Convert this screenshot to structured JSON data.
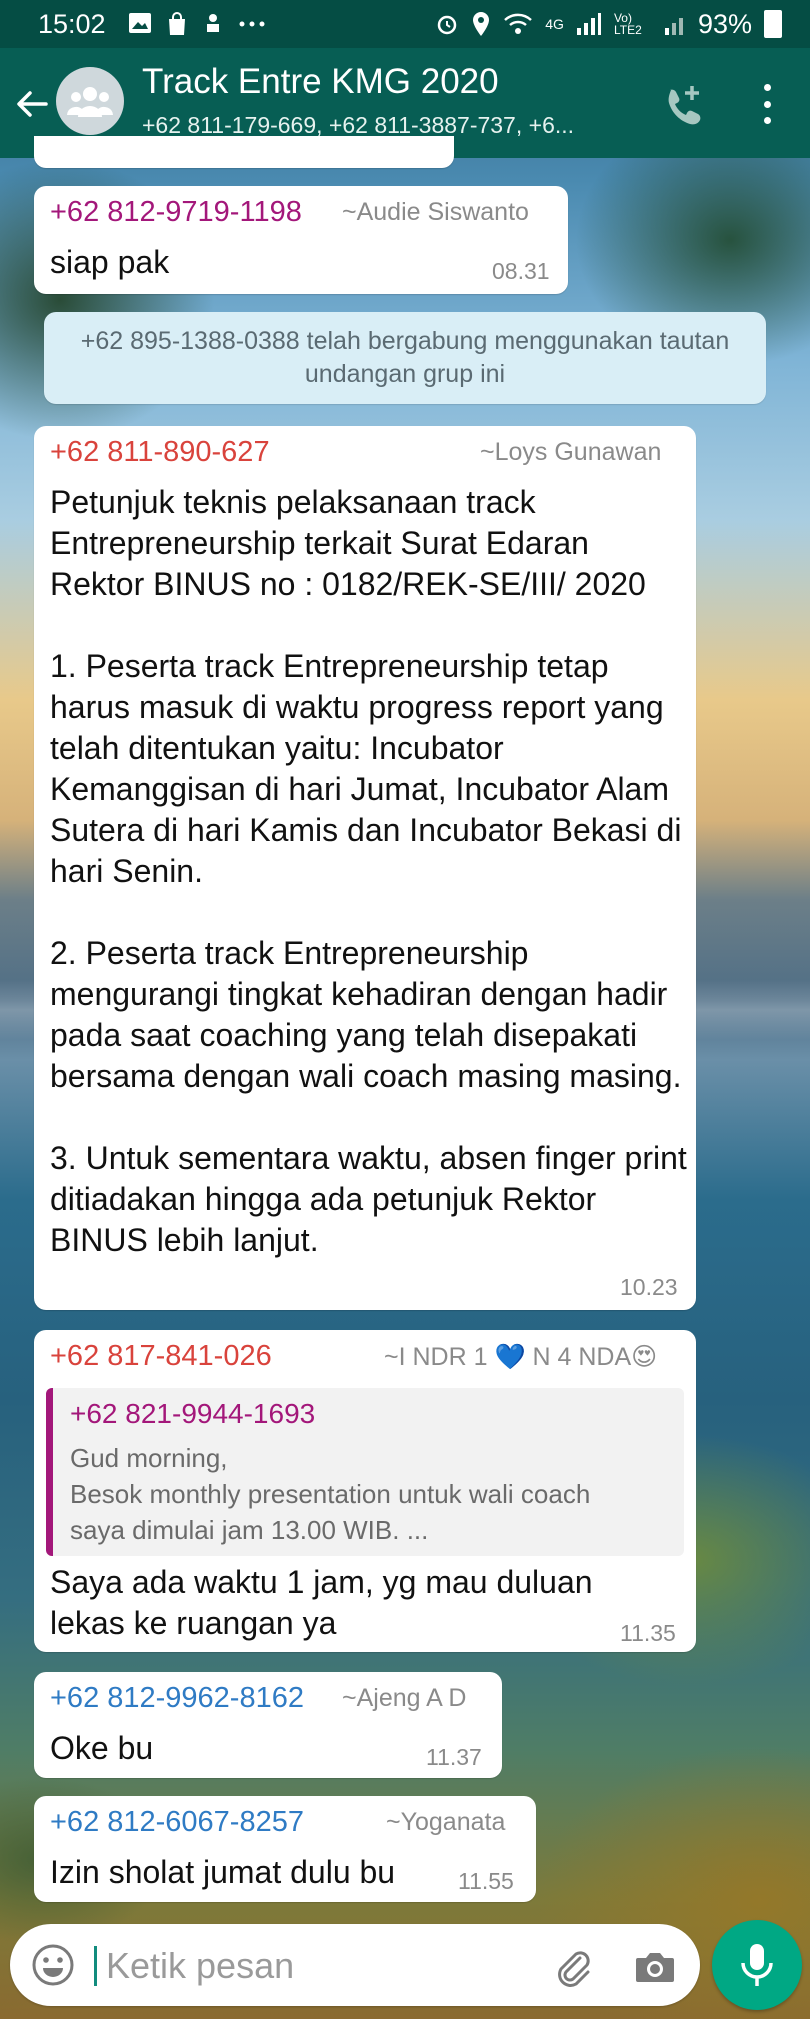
{
  "status_bar": {
    "time": "15:02",
    "network_label": "4G",
    "volte_label": "Vo) LTE2",
    "battery": "93%"
  },
  "header": {
    "title": "Track Entre KMG 2020",
    "subtitle": "+62 811-179-669, +62 811-3887-737, +6..."
  },
  "messages": [
    {
      "sender": "+62 812-9719-1198",
      "sender_color": "#a3177a",
      "alias": "~Audie Siswanto",
      "text": "siap pak",
      "time": "08.31"
    },
    {
      "type": "system",
      "text": "+62 895-1388-0388 telah bergabung menggunakan tautan undangan grup ini"
    },
    {
      "sender": "+62 811-890-627",
      "sender_color": "#d9433c",
      "alias": "~Loys Gunawan",
      "text": "Petunjuk teknis pelaksanaan track Entrepreneurship terkait Surat Edaran Rektor BINUS no : 0182/REK-SE/III/ 2020\n\n1. Peserta track Entrepreneurship tetap harus masuk di waktu progress report yang telah ditentukan yaitu: Incubator Kemanggisan di hari Jumat, Incubator Alam Sutera di hari Kamis dan Incubator Bekasi di hari Senin.\n\n2. Peserta track Entrepreneurship\nmengurangi tingkat kehadiran dengan hadir pada saat coaching yang telah disepakati bersama dengan wali coach masing masing.\n\n3. Untuk sementara waktu, absen finger print ditiadakan hingga ada petunjuk Rektor BINUS lebih lanjut.",
      "time": "10.23"
    },
    {
      "sender": "+62 817-841-026",
      "sender_color": "#d9433c",
      "alias": "~I NDR 1 💙 N 4 NDA😍",
      "quoted_sender": "+62 821-9944-1693",
      "quoted_text": "Gud morning,\nBesok monthly presentation untuk wali coach saya dimulai jam 13.00 WIB. ...",
      "text": "Saya ada waktu 1 jam, yg mau duluan lekas ke ruangan ya",
      "time": "11.35"
    },
    {
      "sender": "+62 812-9962-8162",
      "sender_color": "#2f7bc4",
      "alias": "~Ajeng A D",
      "text": "Oke bu",
      "time": "11.37"
    },
    {
      "sender": "+62 812-6067-8257",
      "sender_color": "#2f7bc4",
      "alias": "~Yoganata",
      "text": "Izin sholat jumat dulu bu",
      "time": "11.55"
    }
  ],
  "input": {
    "placeholder": "Ketik pesan"
  },
  "colors": {
    "header": "#075e54",
    "status_bar": "#054d44",
    "mic_button": "#00a884",
    "quote_accent": "#a3177a"
  }
}
